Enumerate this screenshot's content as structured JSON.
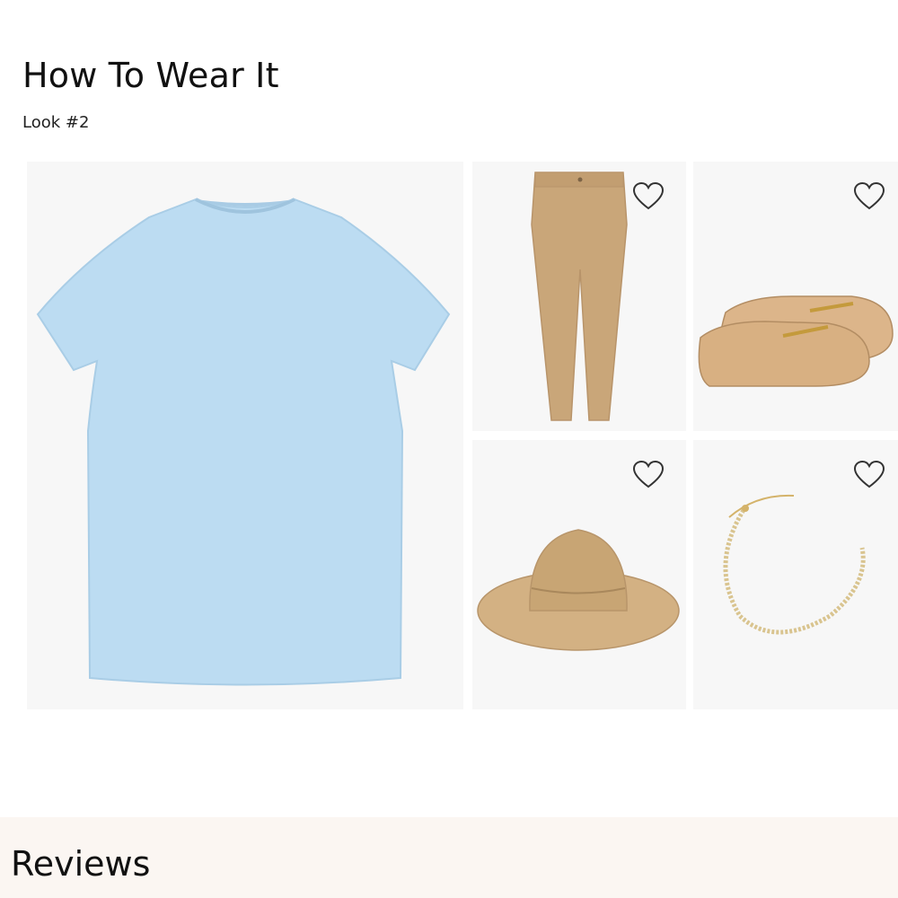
{
  "section": {
    "title": "How To Wear It",
    "subtitle": "Look #2"
  },
  "outfit_items": [
    {
      "name": "light blue crewneck t-shirt",
      "color": "#bcdcf2",
      "favorite": false
    },
    {
      "name": "khaki chino pants",
      "color": "#c9a679",
      "favorite": false
    },
    {
      "name": "woven straw loafer mules",
      "color": "#dcb58a",
      "favorite": false
    },
    {
      "name": "straw sun hat",
      "color": "#d3b183",
      "favorite": false
    },
    {
      "name": "gold chain necklace",
      "color": "#d9c48f",
      "favorite": false
    }
  ],
  "icons": {
    "favorite": "heart-outline-icon"
  },
  "reviews": {
    "title": "Reviews"
  },
  "colors": {
    "tile_background": "#f7f7f7",
    "reviews_band": "#fbf6f2"
  }
}
